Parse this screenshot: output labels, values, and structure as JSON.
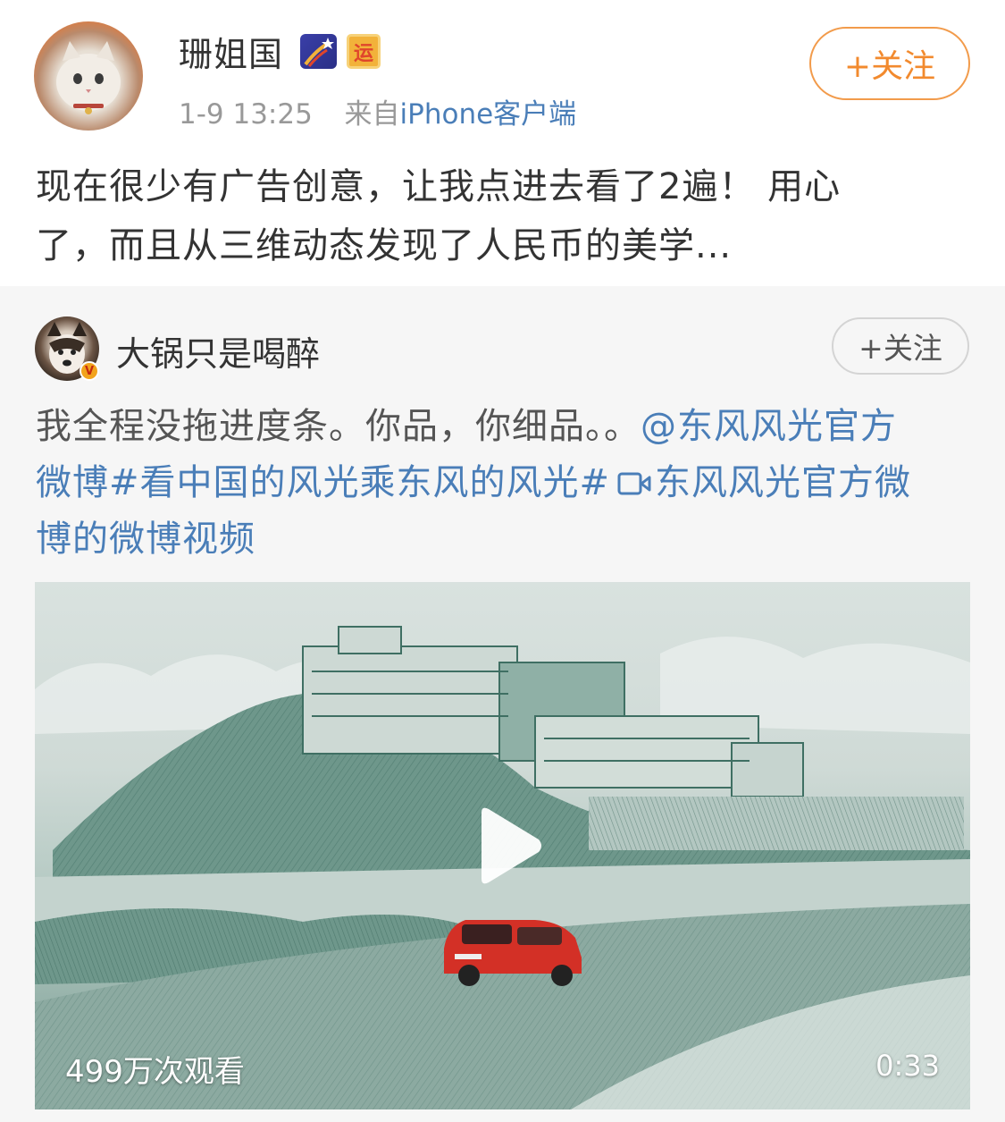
{
  "post": {
    "username": "珊姐国",
    "badge_yun": "运",
    "time": "1-9 13:25",
    "source_prefix": "来自",
    "source": "iPhone客户端",
    "follow": "+关注",
    "text_line1": "现在很少有广告创意，让我点进去看了2遍！ 用心",
    "text_line2": "了，而且从三维动态发现了人民币的美学..."
  },
  "repost": {
    "username": "大锅只是喝醉",
    "verified": "V",
    "follow": "+关注",
    "text_plain": "我全程没拖进度条。你品，你细品。。",
    "mention": "@东风风光官方",
    "hashtag_prefix": "微博",
    "hashtag": "#看中国的风光乘东风的风光#",
    "video_link_line1": "东风风光官方微",
    "video_link_line2": "博的微博视频",
    "video": {
      "views": "499万次观看",
      "duration": "0:33"
    }
  },
  "icons": {
    "badge_star": "shooting-star-badge-icon",
    "badge_yun": "yun-badge-icon",
    "verified": "verified-v-icon",
    "video_link": "video-link-icon",
    "play": "play-icon"
  },
  "colors": {
    "link": "#4a7eb8",
    "follow_orange": "#f28a2e",
    "meta_gray": "#999999",
    "repost_bg": "#f6f6f6"
  }
}
